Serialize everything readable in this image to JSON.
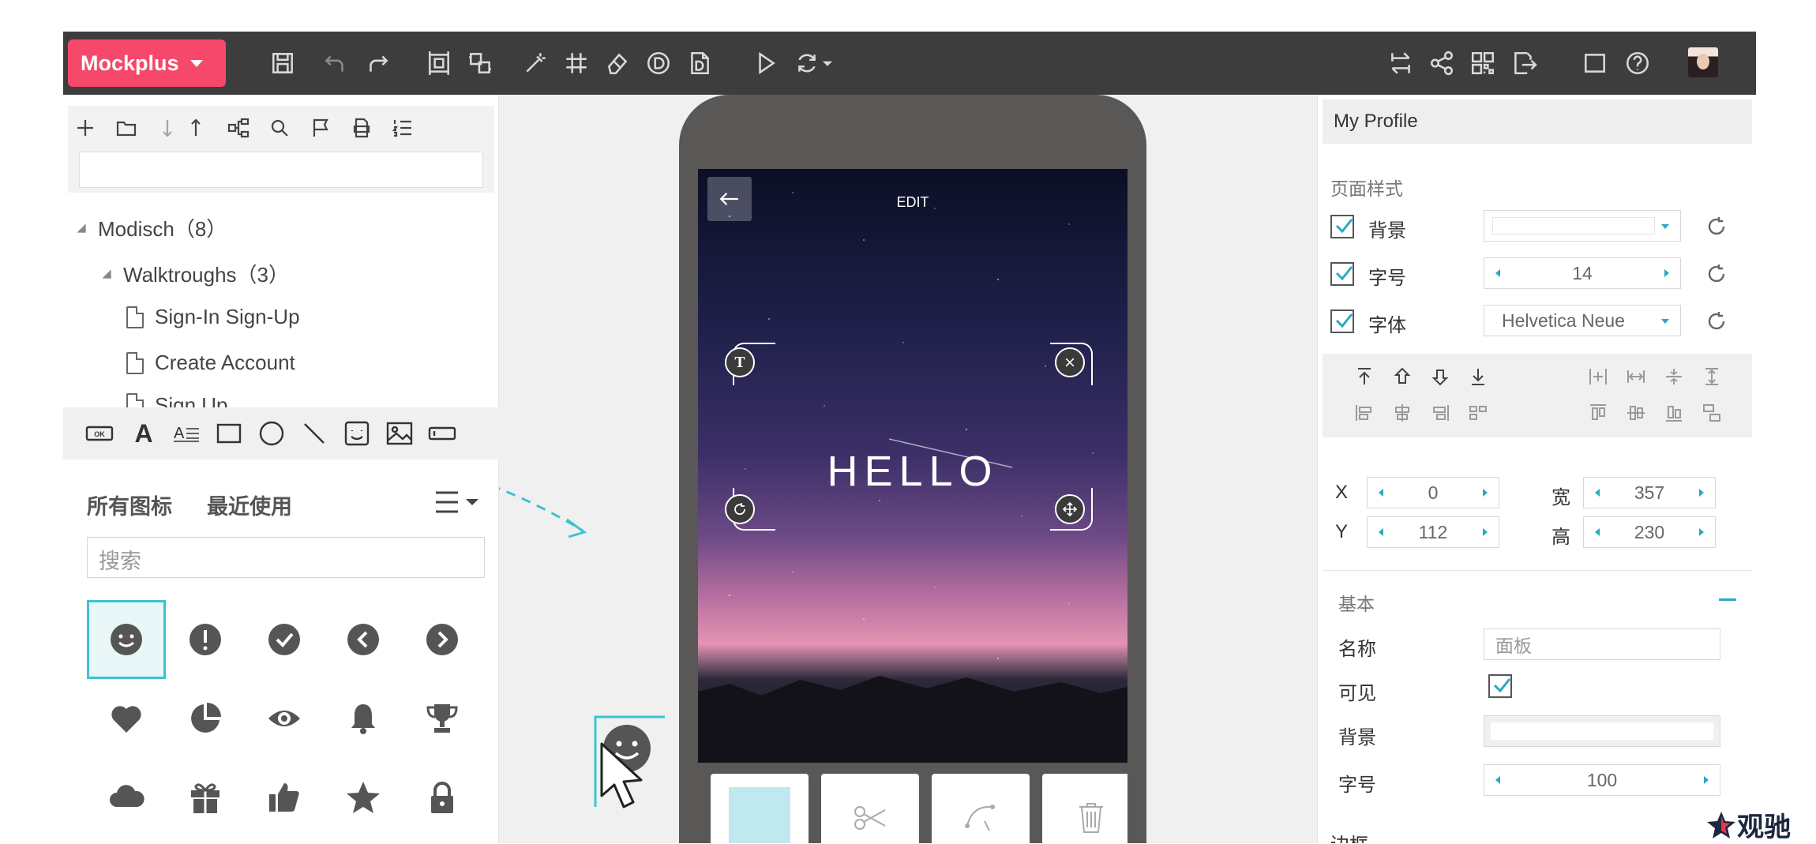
{
  "toolbar": {
    "brand": "Mockplus"
  },
  "left": {
    "tree": {
      "root": "Modisch（8）",
      "folder": "Walktroughs（3）",
      "pages": [
        "Sign-In Sign-Up",
        "Create Account",
        "Sign Up"
      ]
    },
    "components": {
      "button_icon_text": "OK",
      "text_icon": "A",
      "label_icon": "A"
    },
    "icon_panel": {
      "tab_all": "所有图标",
      "tab_recent": "最近使用",
      "search_placeholder": "搜索",
      "icons": [
        "smile-icon",
        "exclamation-icon",
        "check-icon",
        "chevron-left-icon",
        "chevron-right-icon",
        "heart-icon",
        "pie-chart-icon",
        "eye-icon",
        "bell-icon",
        "trophy-icon",
        "cloud-icon",
        "gift-icon",
        "thumbs-up-icon",
        "star-icon",
        "lock-icon"
      ]
    }
  },
  "canvas": {
    "screen": {
      "edit_label": "EDIT",
      "hello_text": "HELLO",
      "text_handle": "T"
    }
  },
  "right": {
    "title": "My Profile",
    "page_style_header": "页面样式",
    "bg_label": "背景",
    "fontsize_label": "字号",
    "fontsize_value": "14",
    "font_label": "字体",
    "font_value": "Helvetica Neue",
    "x_label": "X",
    "x_value": "0",
    "y_label": "Y",
    "y_value": "112",
    "w_label": "宽",
    "w_value": "357",
    "h_label": "高",
    "h_value": "230",
    "basic_header": "基本",
    "name_label": "名称",
    "name_placeholder": "面板",
    "visible_label": "可见",
    "basic_bg_label": "背景",
    "basic_fontsize_label": "字号",
    "basic_fontsize_value": "100",
    "border_label": "边框"
  },
  "watermark": {
    "text": "观驰"
  },
  "colors": {
    "toolbar": "#3d3d3d",
    "brand": "#f5486a",
    "accent": "#3cc3d4"
  }
}
